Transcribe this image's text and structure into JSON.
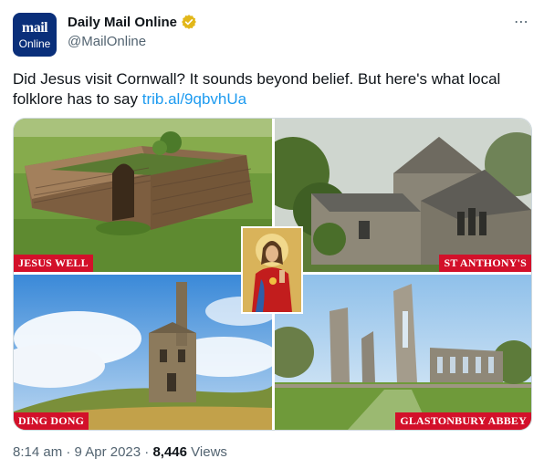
{
  "account": {
    "logo_line1": "mail",
    "logo_line2": "Online",
    "display_name": "Daily Mail Online",
    "handle": "@MailOnline",
    "more_icon": "⋯"
  },
  "tweet": {
    "text": "Did Jesus visit Cornwall? It sounds beyond belief. But here's what local folklore has to say ",
    "link": "trib.al/9qbvhUa"
  },
  "media": {
    "captions": [
      "JESUS WELL",
      "ST ANTHONY'S",
      "DING DONG",
      "GLASTONBURY ABBEY"
    ],
    "caption_color": "#d3102a"
  },
  "meta": {
    "time": "8:14 am",
    "sep1": " · ",
    "date": "9 Apr 2023",
    "sep2": " · ",
    "views_count": "8,446",
    "views_label": " Views"
  },
  "colors": {
    "link": "#1d9bf0",
    "secondary_text": "#536471",
    "verified_badge": "#e2b719",
    "logo_bg": "#0a2f7a"
  }
}
